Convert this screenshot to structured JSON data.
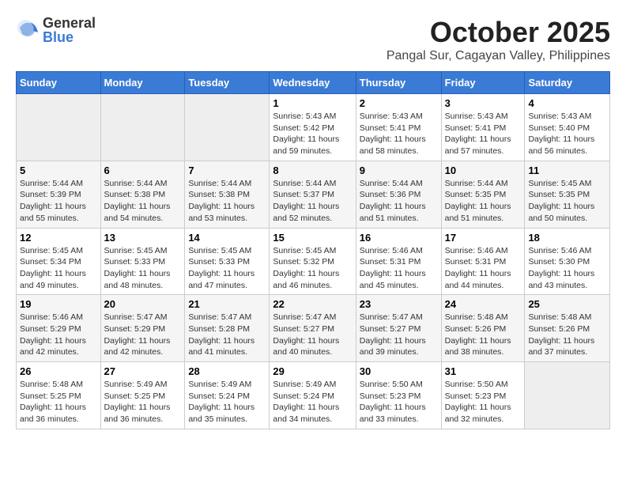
{
  "logo": {
    "general": "General",
    "blue": "Blue"
  },
  "title": "October 2025",
  "subtitle": "Pangal Sur, Cagayan Valley, Philippines",
  "weekdays": [
    "Sunday",
    "Monday",
    "Tuesday",
    "Wednesday",
    "Thursday",
    "Friday",
    "Saturday"
  ],
  "weeks": [
    [
      {
        "day": "",
        "sunrise": "",
        "sunset": "",
        "daylight": ""
      },
      {
        "day": "",
        "sunrise": "",
        "sunset": "",
        "daylight": ""
      },
      {
        "day": "",
        "sunrise": "",
        "sunset": "",
        "daylight": ""
      },
      {
        "day": "1",
        "sunrise": "Sunrise: 5:43 AM",
        "sunset": "Sunset: 5:42 PM",
        "daylight": "Daylight: 11 hours and 59 minutes."
      },
      {
        "day": "2",
        "sunrise": "Sunrise: 5:43 AM",
        "sunset": "Sunset: 5:41 PM",
        "daylight": "Daylight: 11 hours and 58 minutes."
      },
      {
        "day": "3",
        "sunrise": "Sunrise: 5:43 AM",
        "sunset": "Sunset: 5:41 PM",
        "daylight": "Daylight: 11 hours and 57 minutes."
      },
      {
        "day": "4",
        "sunrise": "Sunrise: 5:43 AM",
        "sunset": "Sunset: 5:40 PM",
        "daylight": "Daylight: 11 hours and 56 minutes."
      }
    ],
    [
      {
        "day": "5",
        "sunrise": "Sunrise: 5:44 AM",
        "sunset": "Sunset: 5:39 PM",
        "daylight": "Daylight: 11 hours and 55 minutes."
      },
      {
        "day": "6",
        "sunrise": "Sunrise: 5:44 AM",
        "sunset": "Sunset: 5:38 PM",
        "daylight": "Daylight: 11 hours and 54 minutes."
      },
      {
        "day": "7",
        "sunrise": "Sunrise: 5:44 AM",
        "sunset": "Sunset: 5:38 PM",
        "daylight": "Daylight: 11 hours and 53 minutes."
      },
      {
        "day": "8",
        "sunrise": "Sunrise: 5:44 AM",
        "sunset": "Sunset: 5:37 PM",
        "daylight": "Daylight: 11 hours and 52 minutes."
      },
      {
        "day": "9",
        "sunrise": "Sunrise: 5:44 AM",
        "sunset": "Sunset: 5:36 PM",
        "daylight": "Daylight: 11 hours and 51 minutes."
      },
      {
        "day": "10",
        "sunrise": "Sunrise: 5:44 AM",
        "sunset": "Sunset: 5:35 PM",
        "daylight": "Daylight: 11 hours and 51 minutes."
      },
      {
        "day": "11",
        "sunrise": "Sunrise: 5:45 AM",
        "sunset": "Sunset: 5:35 PM",
        "daylight": "Daylight: 11 hours and 50 minutes."
      }
    ],
    [
      {
        "day": "12",
        "sunrise": "Sunrise: 5:45 AM",
        "sunset": "Sunset: 5:34 PM",
        "daylight": "Daylight: 11 hours and 49 minutes."
      },
      {
        "day": "13",
        "sunrise": "Sunrise: 5:45 AM",
        "sunset": "Sunset: 5:33 PM",
        "daylight": "Daylight: 11 hours and 48 minutes."
      },
      {
        "day": "14",
        "sunrise": "Sunrise: 5:45 AM",
        "sunset": "Sunset: 5:33 PM",
        "daylight": "Daylight: 11 hours and 47 minutes."
      },
      {
        "day": "15",
        "sunrise": "Sunrise: 5:45 AM",
        "sunset": "Sunset: 5:32 PM",
        "daylight": "Daylight: 11 hours and 46 minutes."
      },
      {
        "day": "16",
        "sunrise": "Sunrise: 5:46 AM",
        "sunset": "Sunset: 5:31 PM",
        "daylight": "Daylight: 11 hours and 45 minutes."
      },
      {
        "day": "17",
        "sunrise": "Sunrise: 5:46 AM",
        "sunset": "Sunset: 5:31 PM",
        "daylight": "Daylight: 11 hours and 44 minutes."
      },
      {
        "day": "18",
        "sunrise": "Sunrise: 5:46 AM",
        "sunset": "Sunset: 5:30 PM",
        "daylight": "Daylight: 11 hours and 43 minutes."
      }
    ],
    [
      {
        "day": "19",
        "sunrise": "Sunrise: 5:46 AM",
        "sunset": "Sunset: 5:29 PM",
        "daylight": "Daylight: 11 hours and 42 minutes."
      },
      {
        "day": "20",
        "sunrise": "Sunrise: 5:47 AM",
        "sunset": "Sunset: 5:29 PM",
        "daylight": "Daylight: 11 hours and 42 minutes."
      },
      {
        "day": "21",
        "sunrise": "Sunrise: 5:47 AM",
        "sunset": "Sunset: 5:28 PM",
        "daylight": "Daylight: 11 hours and 41 minutes."
      },
      {
        "day": "22",
        "sunrise": "Sunrise: 5:47 AM",
        "sunset": "Sunset: 5:27 PM",
        "daylight": "Daylight: 11 hours and 40 minutes."
      },
      {
        "day": "23",
        "sunrise": "Sunrise: 5:47 AM",
        "sunset": "Sunset: 5:27 PM",
        "daylight": "Daylight: 11 hours and 39 minutes."
      },
      {
        "day": "24",
        "sunrise": "Sunrise: 5:48 AM",
        "sunset": "Sunset: 5:26 PM",
        "daylight": "Daylight: 11 hours and 38 minutes."
      },
      {
        "day": "25",
        "sunrise": "Sunrise: 5:48 AM",
        "sunset": "Sunset: 5:26 PM",
        "daylight": "Daylight: 11 hours and 37 minutes."
      }
    ],
    [
      {
        "day": "26",
        "sunrise": "Sunrise: 5:48 AM",
        "sunset": "Sunset: 5:25 PM",
        "daylight": "Daylight: 11 hours and 36 minutes."
      },
      {
        "day": "27",
        "sunrise": "Sunrise: 5:49 AM",
        "sunset": "Sunset: 5:25 PM",
        "daylight": "Daylight: 11 hours and 36 minutes."
      },
      {
        "day": "28",
        "sunrise": "Sunrise: 5:49 AM",
        "sunset": "Sunset: 5:24 PM",
        "daylight": "Daylight: 11 hours and 35 minutes."
      },
      {
        "day": "29",
        "sunrise": "Sunrise: 5:49 AM",
        "sunset": "Sunset: 5:24 PM",
        "daylight": "Daylight: 11 hours and 34 minutes."
      },
      {
        "day": "30",
        "sunrise": "Sunrise: 5:50 AM",
        "sunset": "Sunset: 5:23 PM",
        "daylight": "Daylight: 11 hours and 33 minutes."
      },
      {
        "day": "31",
        "sunrise": "Sunrise: 5:50 AM",
        "sunset": "Sunset: 5:23 PM",
        "daylight": "Daylight: 11 hours and 32 minutes."
      },
      {
        "day": "",
        "sunrise": "",
        "sunset": "",
        "daylight": ""
      }
    ]
  ]
}
